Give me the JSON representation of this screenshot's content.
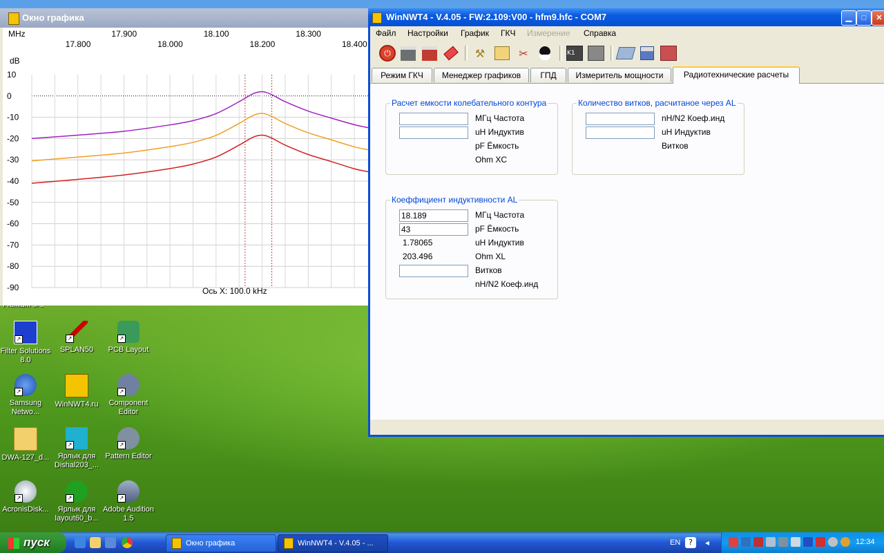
{
  "graph_window": {
    "title": "Окно графика",
    "top_axis_unit": "MHz",
    "top_ticks_row1": [
      "17.900",
      "18.100",
      "18.300",
      "18"
    ],
    "top_ticks_row2": [
      "17.800",
      "18.000",
      "18.200",
      "18.400"
    ],
    "y_unit": "dB",
    "x_axis_caption": "Ось X: 100.0 kHz"
  },
  "chart_data": {
    "type": "line",
    "title": "",
    "xlabel": "Ось X: 100.0 kHz",
    "ylabel": "dB",
    "x_unit": "MHz",
    "xlim": [
      17.7,
      18.43
    ],
    "ylim": [
      -90,
      10
    ],
    "y_ticks": [
      10,
      0,
      -10,
      -20,
      -30,
      -40,
      -50,
      -60,
      -70,
      -80,
      -90
    ],
    "grid": true,
    "markers_mhz": [
      18.163,
      18.221
    ],
    "series": [
      {
        "color": "#a020c0",
        "x": [
          17.7,
          17.8,
          17.9,
          18.0,
          18.05,
          18.1,
          18.15,
          18.18,
          18.2,
          18.22,
          18.25,
          18.3,
          18.35,
          18.4,
          18.43
        ],
        "y": [
          -20,
          -18.4,
          -16.6,
          -13.6,
          -11.6,
          -8.3,
          -2.7,
          1,
          2,
          0.7,
          -2.7,
          -7.1,
          -10.4,
          -13.5,
          -14.9
        ]
      },
      {
        "color": "#f0a020",
        "x": [
          17.7,
          17.8,
          17.9,
          18.0,
          18.05,
          18.1,
          18.15,
          18.18,
          18.2,
          18.22,
          18.25,
          18.3,
          18.35,
          18.4,
          18.43
        ],
        "y": [
          -30.5,
          -28.7,
          -26.8,
          -23.8,
          -21.8,
          -18.5,
          -12.9,
          -9.2,
          -8.2,
          -9.5,
          -12.9,
          -17.3,
          -20.6,
          -23.9,
          -25.3
        ]
      },
      {
        "color": "#d02020",
        "x": [
          17.7,
          17.8,
          17.9,
          18.0,
          18.05,
          18.1,
          18.15,
          18.18,
          18.2,
          18.22,
          18.25,
          18.3,
          18.35,
          18.4,
          18.43
        ],
        "y": [
          -41,
          -39.2,
          -37.1,
          -34.1,
          -32,
          -28.7,
          -23.1,
          -19.4,
          -18.4,
          -19.7,
          -23.1,
          -27.5,
          -30.8,
          -34.2,
          -35.6
        ]
      }
    ]
  },
  "main_window": {
    "title": "WinNWT4 - V.4.05 - FW:2.109:V00 - hfm9.hfc - COM7",
    "menu": [
      "Файл",
      "Настройки",
      "График",
      "ГКЧ",
      "Измерение",
      "Справка"
    ],
    "toolbar_icons": [
      "power-icon",
      "printer-icon",
      "printer-color-icon",
      "eraser-icon",
      "tools-icon",
      "chart-icon",
      "screwdriver-icon",
      "tux-icon",
      "chart-k1-icon",
      "chart-k2-icon",
      "folder-open-icon",
      "save-icon",
      "delete-icon"
    ],
    "tabs": [
      "Режим ГКЧ",
      "Менеджер графиков",
      "ГПД",
      "Измеритель мощности",
      "Радиотехнические расчеты"
    ],
    "active_tab": "Радиотехнические расчеты",
    "group1": {
      "title": "Расчет емкости колебательного контура",
      "freq_value": "",
      "ind_value": "",
      "labels": [
        "МГц Частота",
        "uH Индуктив",
        "pF Ёмкость",
        "Ohm XC"
      ]
    },
    "group2": {
      "title": "Количество витков, расчитаное через AL",
      "al_value": "",
      "ind_value": "",
      "labels": [
        "nH/N2 Коеф.инд",
        "uH Индуктив",
        "Витков"
      ]
    },
    "group3": {
      "title": "Коеффициент индуктивности AL",
      "freq_value": "18.189",
      "cap_value": "43",
      "ind_result": "1.78065",
      "xl_result": "203.496",
      "turns_value": "",
      "labels": [
        "МГц Частота",
        "pF Ёмкость",
        "uH Индуктив",
        "Ohm XL",
        "Витков",
        "nH/N2 Коеф.инд"
      ]
    }
  },
  "desktop": {
    "partial_label": "Premium of 0",
    "icons": [
      {
        "label": "Filter Solutions 8.0"
      },
      {
        "label": "SPLAN50"
      },
      {
        "label": "PCB Layout"
      },
      {
        "label": "Samsung Netwo..."
      },
      {
        "label": "WinNWT4.ru"
      },
      {
        "label": "Component Editor"
      },
      {
        "label": "DWA-127_d..."
      },
      {
        "label": "Ярлык для Dishal203_..."
      },
      {
        "label": "Pattern Editor"
      },
      {
        "label": "AcronisDisk..."
      },
      {
        "label": "Ярлык для layout60_b..."
      },
      {
        "label": "Adobe Audition 1.5"
      }
    ]
  },
  "taskbar": {
    "start_label": "пуск",
    "tasks": [
      "Окно графика",
      "WinNWT4 - V.4.05 - ..."
    ],
    "language": "EN",
    "clock": "12:34"
  }
}
